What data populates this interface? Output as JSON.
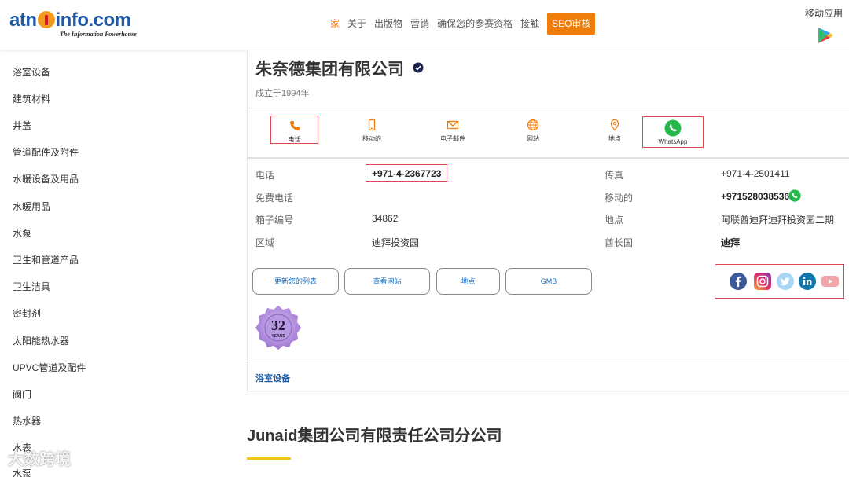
{
  "header": {
    "logo_text": "atnⓘinfo.com",
    "logo_tagline": "The Information Powerhouse",
    "nav": [
      {
        "label": "家",
        "active": true
      },
      {
        "label": "关于"
      },
      {
        "label": "出版物"
      },
      {
        "label": "营销"
      },
      {
        "label": "确保您的参赛资格"
      },
      {
        "label": "接触"
      }
    ],
    "seo_label": "SEO审核",
    "mobile_app_label": "移动应用"
  },
  "sidebar": {
    "items": [
      "浴室设备",
      "建筑材料",
      "井盖",
      "管道配件及附件",
      "水暖设备及用品",
      "水暖用品",
      "水泵",
      "卫生和管道产品",
      "卫生洁具",
      "密封剂",
      "太阳能热水器",
      "UPVC管道及配件",
      "阀门",
      "热水器",
      "水表",
      "水泵"
    ]
  },
  "company": {
    "name": "朱奈德集团有限公司",
    "founded": "成立于1994年",
    "actions": [
      {
        "label": "电话",
        "icon": "phone-icon",
        "highlighted": true
      },
      {
        "label": "移动的",
        "icon": "mobile-icon"
      },
      {
        "label": "电子邮件",
        "icon": "email-icon"
      },
      {
        "label": "网站",
        "icon": "globe-icon"
      },
      {
        "label": "地点",
        "icon": "location-pin-icon"
      },
      {
        "label": "WhatsApp",
        "icon": "whatsapp-icon",
        "highlighted": true
      }
    ],
    "info": {
      "phone_label": "电话",
      "phone_value": "+971-4-2367723",
      "fax_label": "传真",
      "fax_value": "+971-4-2501411",
      "tollfree_label": "免费电话",
      "tollfree_value": "",
      "mobile_label": "移动的",
      "mobile_value": "+971528038536",
      "pobox_label": "箱子编号",
      "pobox_value": "34862",
      "location_label": "地点",
      "location_value": "阿联酋迪拜迪拜投资园二期",
      "area_label": "区域",
      "area_value": "迪拜投资园",
      "emirate_label": "酋长国",
      "emirate_value": "迪拜"
    },
    "buttons": [
      "更新您的列表",
      "查看网站",
      "地点",
      "GMB"
    ],
    "social": [
      "facebook-icon",
      "instagram-icon",
      "twitter-icon",
      "linkedin-icon",
      "youtube-icon"
    ],
    "badge_years": "32",
    "badge_text": "YEARS",
    "category": "浴室设备"
  },
  "next_company": {
    "name": "Junaid集团公司有限责任公司分公司"
  },
  "watermark": "大数跨境",
  "colors": {
    "accent": "#f07c0a",
    "brand": "#1e5aa8",
    "highlight_border": "#e0474c",
    "link": "#1a73c8"
  }
}
